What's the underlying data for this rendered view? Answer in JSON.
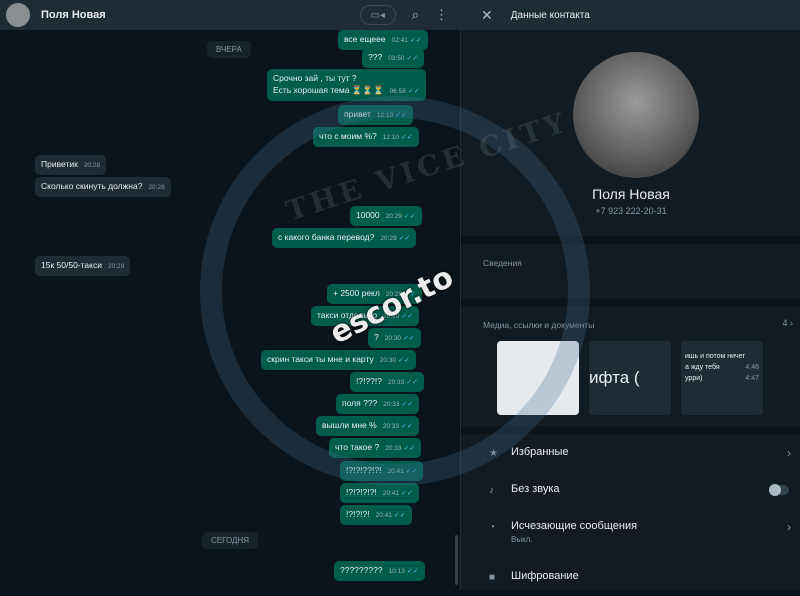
{
  "chat": {
    "title": "Поля Новая",
    "day_yesterday": "ВЧЕРА",
    "day_today": "СЕГОДНЯ",
    "messages": [
      {
        "text": "все ещеее",
        "time": "02:41",
        "dir": "out"
      },
      {
        "text": "???",
        "time": "03:50",
        "dir": "out"
      },
      {
        "text": "Срочно зай , ты тут ?\nЕсть хорошая  тема ⏳⏳⏳",
        "time": "06:58",
        "dir": "out"
      },
      {
        "text": "привет",
        "time": "12:10",
        "dir": "out"
      },
      {
        "text": "что с моим %?",
        "time": "12:10",
        "dir": "out"
      },
      {
        "text": "Приветик",
        "time": "20:28",
        "dir": "in"
      },
      {
        "text": "Сколько скинуть должна?",
        "time": "20:28",
        "dir": "in"
      },
      {
        "text": "10000",
        "time": "20:29",
        "dir": "out"
      },
      {
        "text": "с какого банка перевод?",
        "time": "20:29",
        "dir": "out"
      },
      {
        "text": "15к 50/50-такси",
        "time": "20:29",
        "dir": "in"
      },
      {
        "text": "+ 2500 рекл",
        "time": "20:29",
        "dir": "out"
      },
      {
        "text": "такси отдельно",
        "time": "20:29",
        "dir": "out"
      },
      {
        "text": "?",
        "time": "20:30",
        "dir": "out"
      },
      {
        "text": "скрин такси ты мне и карту",
        "time": "20:30",
        "dir": "out"
      },
      {
        "text": "!?!??!?",
        "time": "20:33",
        "dir": "out"
      },
      {
        "text": "поля ???",
        "time": "20:33",
        "dir": "out"
      },
      {
        "text": "вышли мне %",
        "time": "20:33",
        "dir": "out"
      },
      {
        "text": "что такое ?",
        "time": "20:33",
        "dir": "out"
      },
      {
        "text": "!?!?!??!?!",
        "time": "20:41",
        "dir": "out"
      },
      {
        "text": "!?!?!?!?!",
        "time": "20:41",
        "dir": "out"
      },
      {
        "text": "!?!?!?!",
        "time": "20:41",
        "dir": "out"
      },
      {
        "text": "?????????",
        "time": "10:13",
        "dir": "out"
      }
    ]
  },
  "panel": {
    "title": "Данные контакта",
    "name": "Поля Новая",
    "phone": "+7 923 222-20-31",
    "about_label": "Сведения",
    "media_label": "Медиа, ссылки и документы",
    "media_count": "4",
    "thumb2_text": "ифта (",
    "thumb3_lines": [
      "ишь и потом ничег",
      "а жду тебя",
      "урри)"
    ],
    "thumb3_time": "4:46",
    "thumb3_time2": "4:47",
    "starred": "Избранные",
    "mute": "Без звука",
    "disappearing": "Исчезающие сообщения",
    "disappearing_sub": "Выкл.",
    "encryption": "Шифрование"
  },
  "watermark": {
    "emblem_text": "THE VICE CITY",
    "site": "escor.to"
  }
}
